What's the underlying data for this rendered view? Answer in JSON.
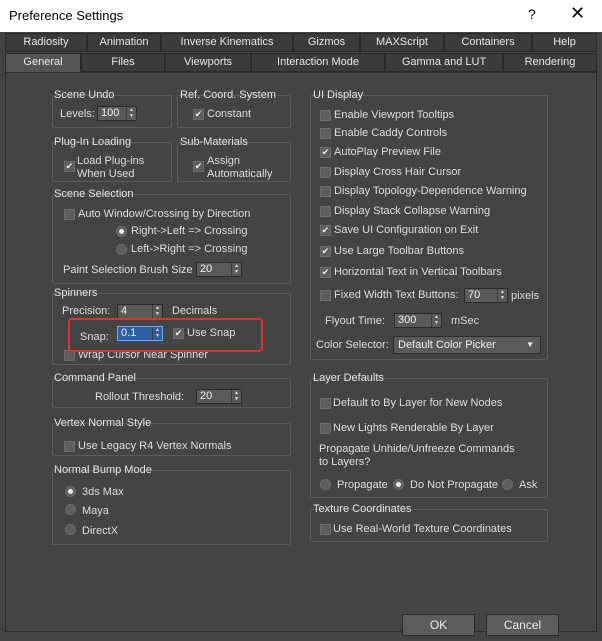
{
  "window": {
    "title": "Preference Settings",
    "help": "?",
    "close": "✕"
  },
  "tabs_row1": [
    "Radiosity",
    "Animation",
    "Inverse Kinematics",
    "Gizmos",
    "MAXScript",
    "Containers",
    "Help"
  ],
  "tabs_row2": [
    "General",
    "Files",
    "Viewports",
    "Interaction Mode",
    "Gamma and LUT",
    "Rendering"
  ],
  "scene_undo": {
    "title": "Scene Undo",
    "levels_label": "Levels:",
    "levels_value": "100"
  },
  "ref_coord": {
    "title": "Ref. Coord. System",
    "constant": "Constant"
  },
  "plugin_loading": {
    "title": "Plug-In Loading",
    "load_line1": "Load Plug-ins",
    "load_line2": "When Used"
  },
  "sub_materials": {
    "title": "Sub-Materials",
    "assign_line1": "Assign",
    "assign_line2": "Automatically"
  },
  "scene_selection": {
    "title": "Scene Selection",
    "auto_window": "Auto Window/Crossing by Direction",
    "right_left": "Right->Left => Crossing",
    "left_right": "Left->Right => Crossing",
    "brush_label": "Paint Selection Brush Size",
    "brush_value": "20"
  },
  "spinners": {
    "title": "Spinners",
    "precision_label": "Precision:",
    "precision_value": "4",
    "decimals": "Decimals",
    "snap_label": "Snap:",
    "snap_value": "0.1",
    "use_snap": "Use Snap",
    "wrap_cursor": "Wrap Cursor Near Spinner"
  },
  "command_panel": {
    "title": "Command Panel",
    "rollout_label": "Rollout Threshold:",
    "rollout_value": "20"
  },
  "vertex_normal": {
    "title": "Vertex Normal Style",
    "legacy": "Use Legacy R4 Vertex Normals"
  },
  "normal_bump": {
    "title": "Normal Bump Mode",
    "opt1": "3ds Max",
    "opt2": "Maya",
    "opt3": "DirectX"
  },
  "ui_display": {
    "title": "UI Display",
    "items": [
      "Enable Viewport Tooltips",
      "Enable Caddy Controls",
      "AutoPlay Preview File",
      "Display Cross Hair Cursor",
      "Display Topology-Dependence Warning",
      "Display Stack Collapse Warning",
      "Save UI Configuration on Exit",
      "Use Large Toolbar Buttons",
      "Horizontal Text in Vertical Toolbars"
    ],
    "fixed_width": "Fixed Width Text Buttons:",
    "fixed_width_value": "70",
    "pixels": "pixels",
    "flyout_label": "Flyout Time:",
    "flyout_value": "300",
    "msec": "mSec",
    "color_selector_label": "Color Selector:",
    "color_selector_value": "Default Color Picker"
  },
  "layer_defaults": {
    "title": "Layer Defaults",
    "default_by_layer": "Default to By Layer for New Nodes",
    "new_lights": "New Lights Renderable By Layer",
    "propagate_q1": "Propagate Unhide/Unfreeze Commands",
    "propagate_q2": "to Layers?",
    "propagate": "Propagate",
    "do_not": "Do Not Propagate",
    "ask": "Ask"
  },
  "texture_coords": {
    "title": "Texture Coordinates",
    "real_world": "Use Real-World Texture Coordinates"
  },
  "buttons": {
    "ok": "OK",
    "cancel": "Cancel"
  },
  "colors": {
    "background": "#444444",
    "highlight": "#e03030",
    "selected_field": "#2d5fa0"
  }
}
